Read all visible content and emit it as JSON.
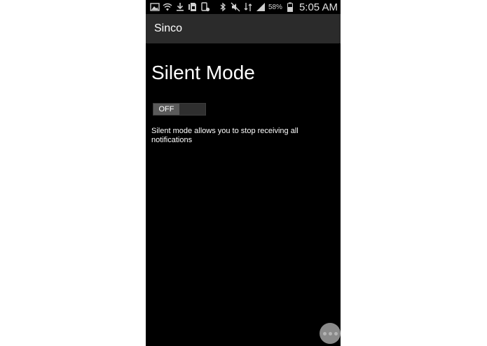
{
  "status_bar": {
    "left_icons": [
      "gallery-icon",
      "wifi-shield-icon",
      "download-icon",
      "sim-icon",
      "screenshot-icon"
    ],
    "right_icons": [
      "bluetooth-icon",
      "mute-icon",
      "network-icon",
      "signal-icon",
      "battery-icon"
    ],
    "battery_percent": "58%",
    "time": "5:05 AM"
  },
  "action_bar": {
    "title": "Sinco"
  },
  "main": {
    "heading": "Silent Mode",
    "toggle": {
      "label": "OFF",
      "state": "off"
    },
    "description": "Silent mode allows you to stop receiving all notifications"
  },
  "fab": {
    "icon": "more-dots-icon"
  }
}
